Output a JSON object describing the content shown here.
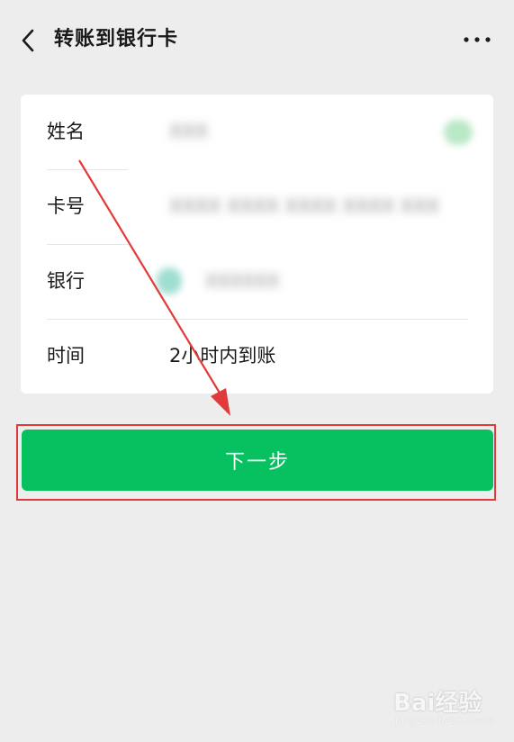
{
  "navbar": {
    "title": "转账到银行卡",
    "back_icon": "chevron-left-icon",
    "more_icon": "more-icon"
  },
  "form": {
    "rows": [
      {
        "label": "姓名",
        "value": "XXX"
      },
      {
        "label": "卡号",
        "value": "XXXX XXXX XXXX XXXX XXX"
      },
      {
        "label": "银行",
        "value": "XXXXXX"
      },
      {
        "label": "时间",
        "value": "2小时内到账"
      }
    ]
  },
  "actions": {
    "next_label": "下一步"
  },
  "watermark": {
    "brand": "Bai经验",
    "url": "jingyan.baidu.com"
  },
  "colors": {
    "background": "#ededed",
    "card": "#ffffff",
    "primary_green": "#07c160",
    "annotation_red": "#e03a3a"
  }
}
